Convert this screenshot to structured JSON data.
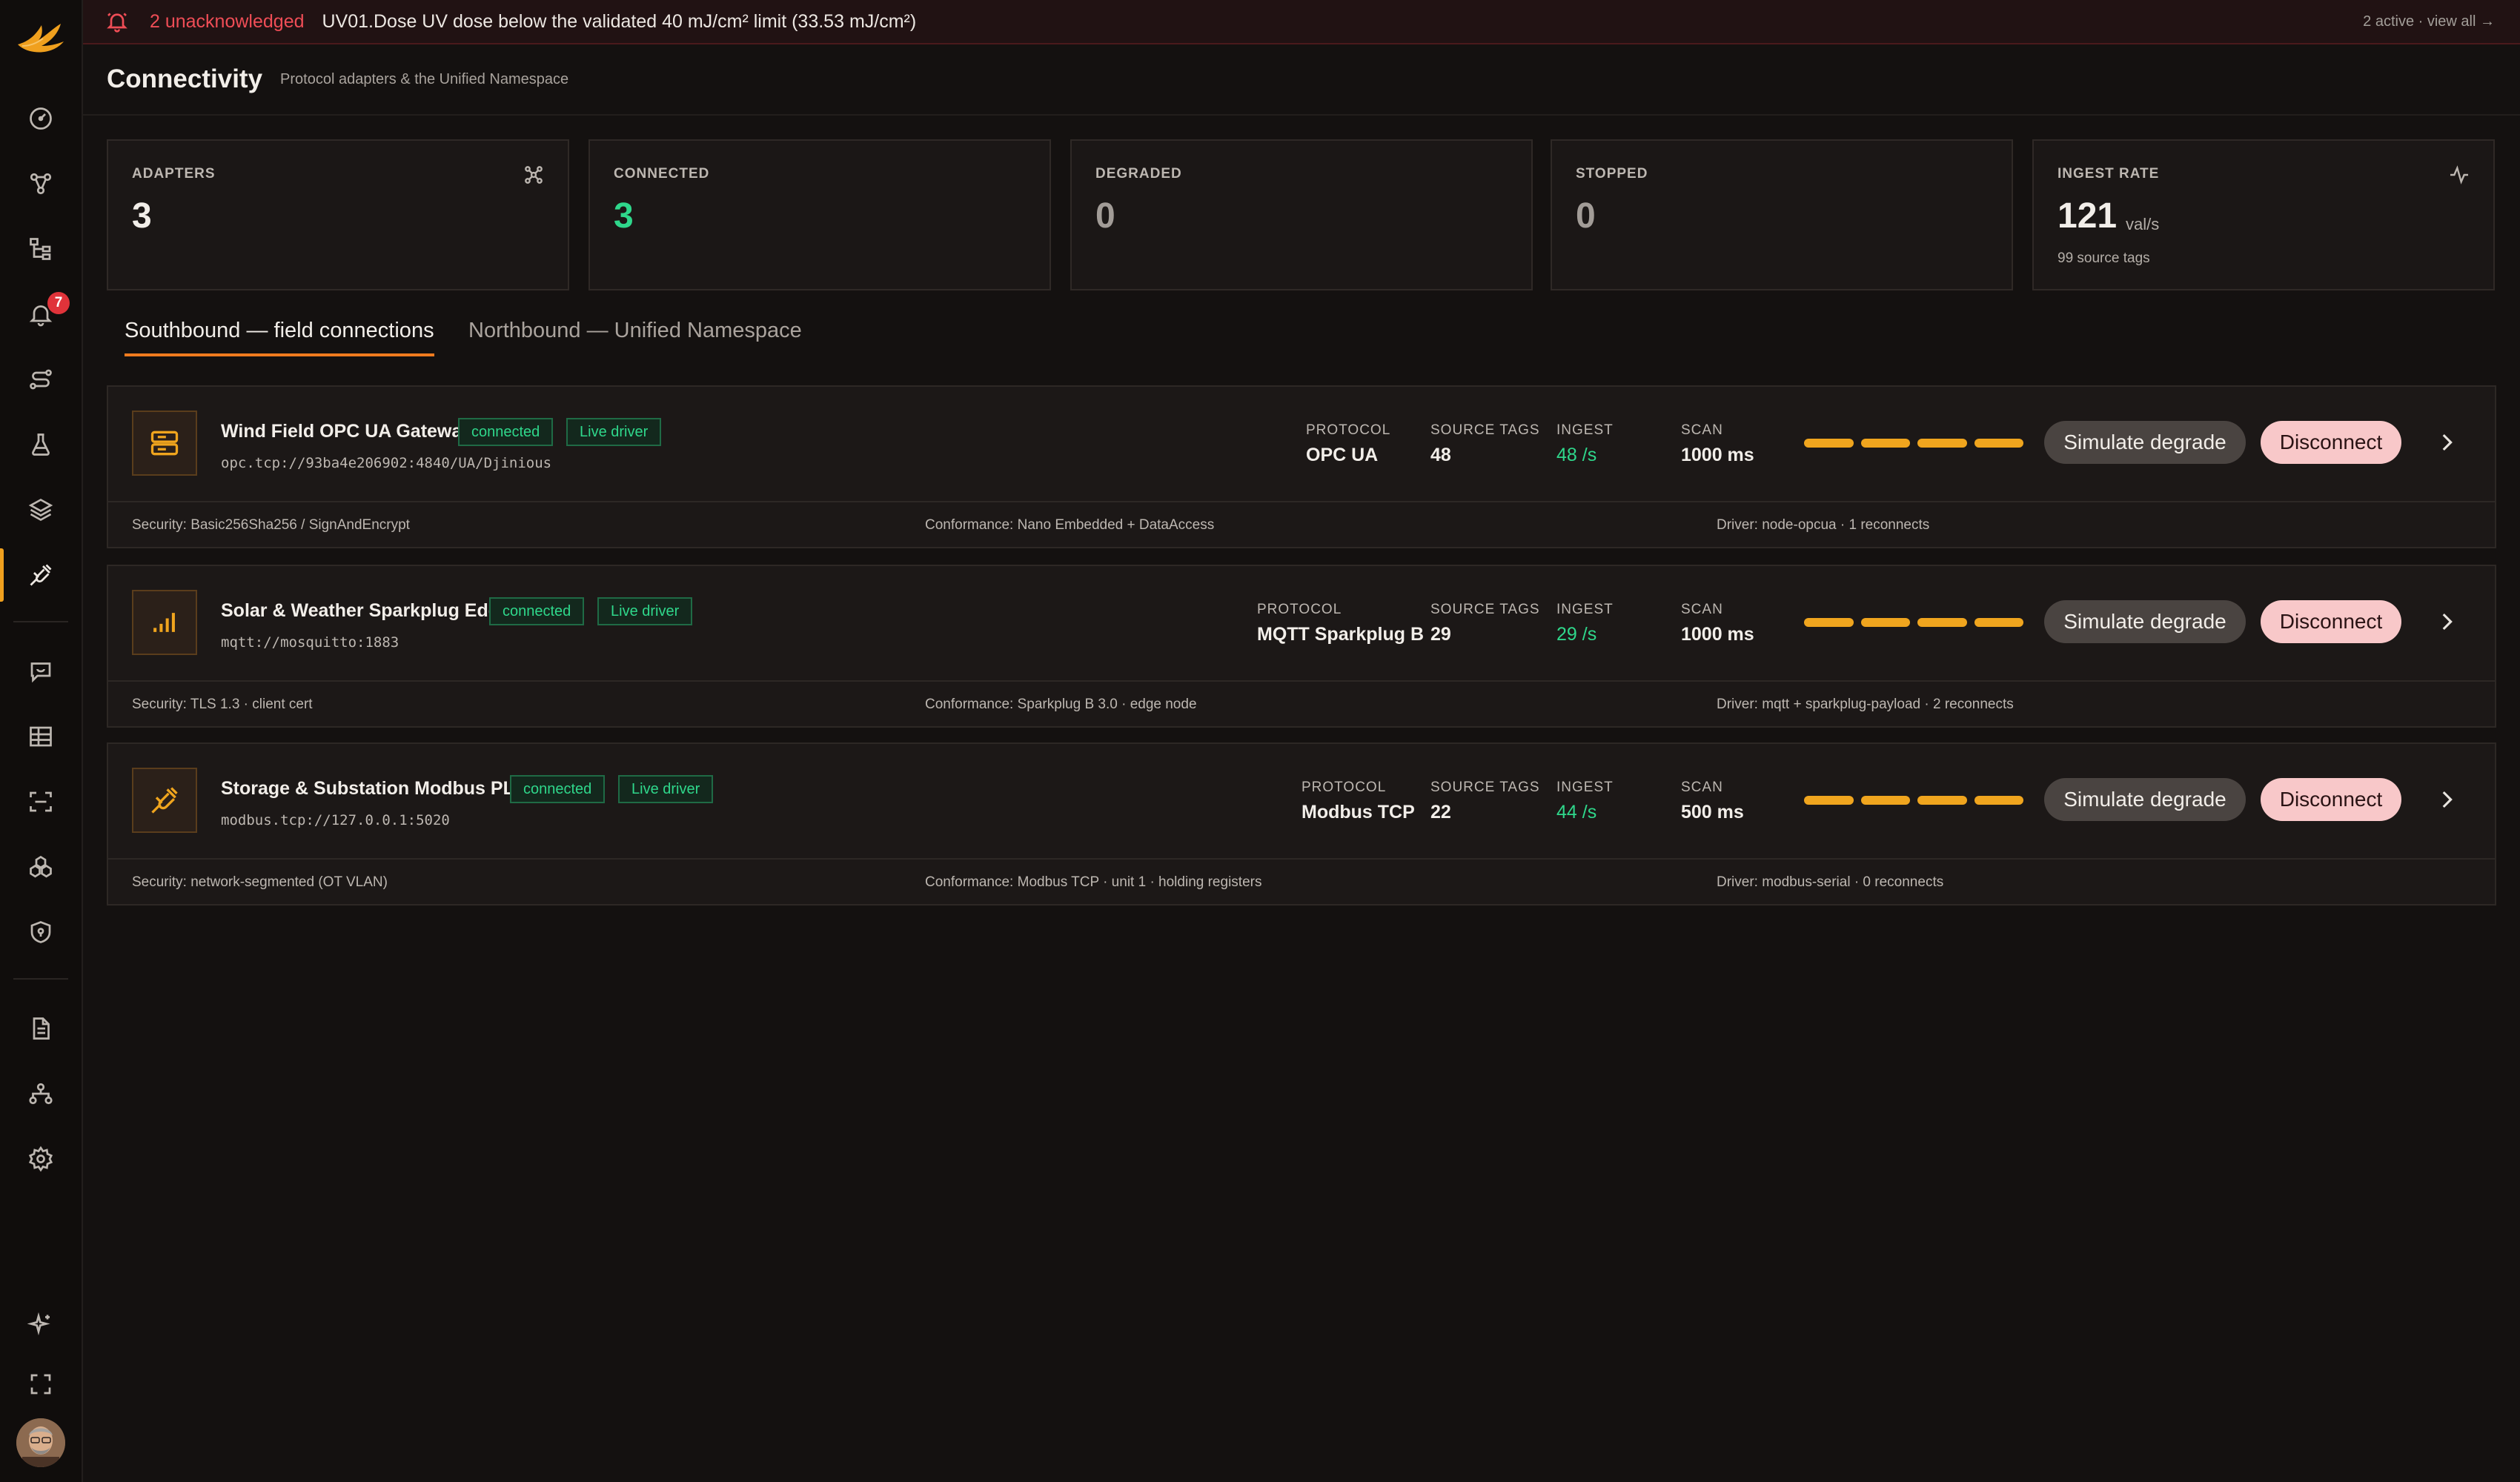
{
  "alert": {
    "count_label": "2 unacknowledged",
    "message": "UV01.Dose UV dose below the validated 40 mJ/cm² limit (33.53 mJ/cm²)",
    "right_link": "2 active · view all →"
  },
  "sidebar": {
    "alarms_badge": "7",
    "items": [
      "dashboard-icon",
      "graph-icon",
      "hierarchy-icon",
      "alarms-icon",
      "routes-icon",
      "lab-flask-icon",
      "layers-icon",
      "connectivity-plug-icon",
      "chat-icon",
      "table-icon",
      "scan-icon",
      "modules-icon",
      "shield-icon",
      "document-icon",
      "org-icon",
      "settings-icon",
      "sparkle-icon",
      "fullscreen-icon"
    ]
  },
  "header": {
    "title": "Connectivity",
    "subtitle": "Protocol adapters & the Unified Namespace"
  },
  "stats": {
    "adapters": {
      "label": "ADAPTERS",
      "value": "3"
    },
    "connected": {
      "label": "CONNECTED",
      "value": "3"
    },
    "degraded": {
      "label": "DEGRADED",
      "value": "0"
    },
    "stopped": {
      "label": "STOPPED",
      "value": "0"
    },
    "ingest": {
      "label": "INGEST RATE",
      "value": "121",
      "unit": "val/s",
      "sub": "99 source tags"
    }
  },
  "tabs": {
    "southbound": "Southbound — field connections",
    "northbound": "Northbound — Unified Namespace"
  },
  "labels": {
    "protocol": "PROTOCOL",
    "source_tags": "SOURCE TAGS",
    "ingest": "INGEST",
    "scan": "SCAN",
    "simulate": "Simulate degrade",
    "disconnect": "Disconnect"
  },
  "adapters": [
    {
      "name": "Wind Field OPC UA Gateway",
      "status": "connected",
      "driver_badge": "Live driver",
      "endpoint": "opc.tcp://93ba4e206902:4840/UA/Djinious",
      "protocol": "OPC UA",
      "source_tags": "48",
      "ingest": "48 /s",
      "scan": "1000 ms",
      "security": "Security: Basic256Sha256 / SignAndEncrypt",
      "conformance": "Conformance: Nano Embedded + DataAccess",
      "driver": "Driver: node-opcua · 1 reconnects"
    },
    {
      "name": "Solar & Weather Sparkplug Edge",
      "status": "connected",
      "driver_badge": "Live driver",
      "endpoint": "mqtt://mosquitto:1883",
      "protocol": "MQTT Sparkplug B",
      "source_tags": "29",
      "ingest": "29 /s",
      "scan": "1000 ms",
      "security": "Security: TLS 1.3 · client cert",
      "conformance": "Conformance: Sparkplug B 3.0 · edge node",
      "driver": "Driver: mqtt + sparkplug-payload · 2 reconnects"
    },
    {
      "name": "Storage & Substation Modbus PLC",
      "status": "connected",
      "driver_badge": "Live driver",
      "endpoint": "modbus.tcp://127.0.0.1:5020",
      "protocol": "Modbus TCP",
      "source_tags": "22",
      "ingest": "44 /s",
      "scan": "500 ms",
      "security": "Security: network-segmented (OT VLAN)",
      "conformance": "Conformance: Modbus TCP · unit 1 · holding registers",
      "driver": "Driver: modbus-serial · 0 reconnects"
    }
  ],
  "colors": {
    "accent": "#f07b1e",
    "ok": "#2fd78b",
    "alert": "#ef4d56",
    "bar": "#f0a51e"
  }
}
